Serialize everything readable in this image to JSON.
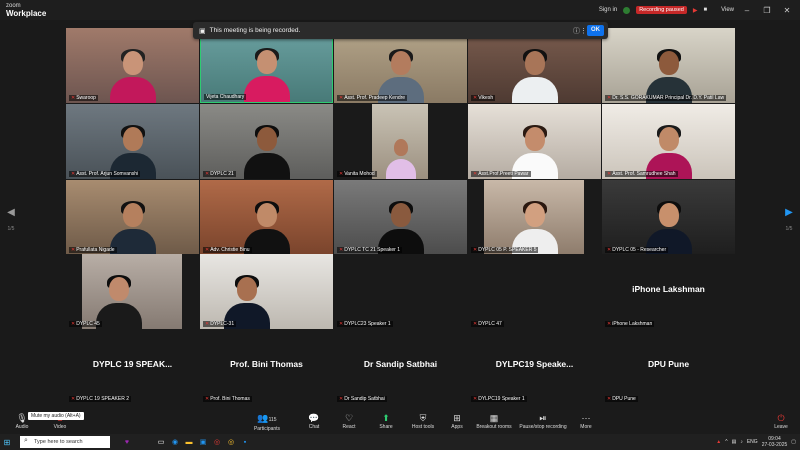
{
  "app": {
    "brand_small": "zoom",
    "brand_big": "Workplace"
  },
  "topbar": {
    "sign_in": "Sign in",
    "recording_status": "Recording paused",
    "view": "View"
  },
  "banner": {
    "text": "This meeting is being recorded.",
    "ok": "OK"
  },
  "pager": {
    "left": "1/5",
    "right": "1/5"
  },
  "tiles": [
    {
      "label": "Swaroop"
    },
    {
      "label": "Vijeta Chaudhary"
    },
    {
      "label": "Asst. Prof. Pradeep Kendre"
    },
    {
      "label": "Vikesh"
    },
    {
      "label": "Dr. S.S. GORAKUMAR Principal Dr. D.Y. Patil Law"
    },
    {
      "label": "Asst. Prof. Arjun Somvanshi"
    },
    {
      "label": "DYPLC 21"
    },
    {
      "label": "Vanita Mohod"
    },
    {
      "label": "Asst.Prof.Preeti Pawar"
    },
    {
      "label": "Asst. Prof. Samrudhee Shah"
    },
    {
      "label": "Prafullata Nigade"
    },
    {
      "label": "Adv. Christie Binu"
    },
    {
      "label": "DYPLC TC 21 Speaker 1"
    },
    {
      "label": "DYPLC 05 P. SPEAKER 5"
    },
    {
      "label": "DYPLC 05 - Researcher"
    },
    {
      "label": "DYPLC 45"
    },
    {
      "label": "DYPLC-31"
    },
    {
      "label": "DYPLC23 Speaker 1"
    },
    {
      "label": "DYPLC 47"
    },
    {
      "label": "iPhone Lakshman",
      "big": "iPhone Lakshman"
    },
    {
      "label": "DYPLC 19 SPEAKER 2",
      "big": "DYPLC 19 SPEAK..."
    },
    {
      "label": "Prof. Bini Thomas",
      "big": "Prof. Bini Thomas"
    },
    {
      "label": "Dr Sandip Satbhai",
      "big": "Dr Sandip Satbhai"
    },
    {
      "label": "DYLPC19 Speaker 1",
      "big": "DYLPC19 Speake..."
    },
    {
      "label": "DPU Pune",
      "big": "DPU Pune"
    }
  ],
  "toolbar": {
    "audio": "Audio",
    "video": "Video",
    "mute_tip": "Mute my audio (Alt+A)",
    "participants": "Participants",
    "participant_count": "115",
    "chat": "Chat",
    "react": "React",
    "share": "Share",
    "host_tools": "Host tools",
    "apps": "Apps",
    "breakout": "Breakout rooms",
    "record": "Pause/stop recording",
    "more": "More",
    "leave": "Leave"
  },
  "taskbar": {
    "search_placeholder": "Type here to search",
    "lang": "ENG",
    "time": "09:04",
    "date": "27-03-2025"
  },
  "colors": {
    "accent": "#0e72ed",
    "recording": "#c62828",
    "leave": "#e53935"
  }
}
